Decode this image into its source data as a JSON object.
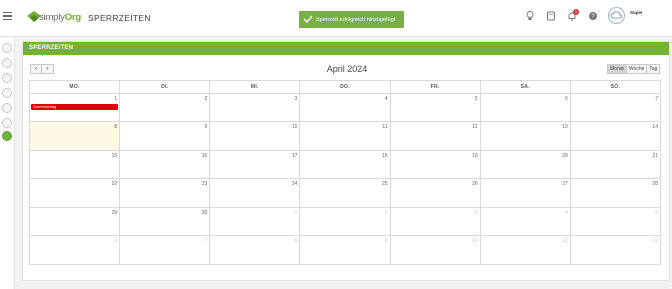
{
  "header": {
    "logo_prefix": "simply",
    "logo_suffix": "Org",
    "page_title": "SPERRZEITEN",
    "notification_count": "1",
    "user_name": "Super"
  },
  "toast": {
    "message": "Sperrzeit erfolgreich hinzugefügt"
  },
  "card": {
    "title": "SPERRZEITEN"
  },
  "calendar": {
    "title": "April 2024",
    "prev_label": "‹",
    "next_label": "›",
    "views": [
      "Monat",
      "Woche",
      "Tag"
    ],
    "active_view": "Monat",
    "weekdays": [
      "MO.",
      "DI.",
      "MI.",
      "DO.",
      "FR.",
      "SA.",
      "SO."
    ],
    "weeks": [
      [
        {
          "n": "1",
          "other": false
        },
        {
          "n": "2",
          "other": false
        },
        {
          "n": "3",
          "other": false
        },
        {
          "n": "4",
          "other": false
        },
        {
          "n": "5",
          "other": false
        },
        {
          "n": "6",
          "other": false
        },
        {
          "n": "7",
          "other": false
        }
      ],
      [
        {
          "n": "8",
          "other": false,
          "today": true
        },
        {
          "n": "9",
          "other": false
        },
        {
          "n": "10",
          "other": false
        },
        {
          "n": "11",
          "other": false
        },
        {
          "n": "12",
          "other": false
        },
        {
          "n": "13",
          "other": false
        },
        {
          "n": "14",
          "other": false
        }
      ],
      [
        {
          "n": "15",
          "other": false
        },
        {
          "n": "16",
          "other": false
        },
        {
          "n": "17",
          "other": false
        },
        {
          "n": "18",
          "other": false
        },
        {
          "n": "19",
          "other": false
        },
        {
          "n": "20",
          "other": false
        },
        {
          "n": "21",
          "other": false
        }
      ],
      [
        {
          "n": "22",
          "other": false
        },
        {
          "n": "23",
          "other": false
        },
        {
          "n": "24",
          "other": false
        },
        {
          "n": "25",
          "other": false
        },
        {
          "n": "26",
          "other": false
        },
        {
          "n": "27",
          "other": false
        },
        {
          "n": "28",
          "other": false
        }
      ],
      [
        {
          "n": "29",
          "other": false
        },
        {
          "n": "30",
          "other": false
        },
        {
          "n": "1",
          "other": true
        },
        {
          "n": "2",
          "other": true
        },
        {
          "n": "3",
          "other": true
        },
        {
          "n": "4",
          "other": true
        },
        {
          "n": "5",
          "other": true
        }
      ],
      [
        {
          "n": "6",
          "other": true
        },
        {
          "n": "7",
          "other": true
        },
        {
          "n": "8",
          "other": true
        },
        {
          "n": "9",
          "other": true
        },
        {
          "n": "10",
          "other": true
        },
        {
          "n": "11",
          "other": true
        },
        {
          "n": "12",
          "other": true
        }
      ]
    ],
    "events": [
      {
        "label": "Ostermontag",
        "week": 0,
        "day": 0,
        "color": "#e00000"
      }
    ]
  },
  "colors": {
    "brand_green": "#74b235",
    "event_red": "#e00000",
    "today_bg": "#fcf8e3"
  }
}
